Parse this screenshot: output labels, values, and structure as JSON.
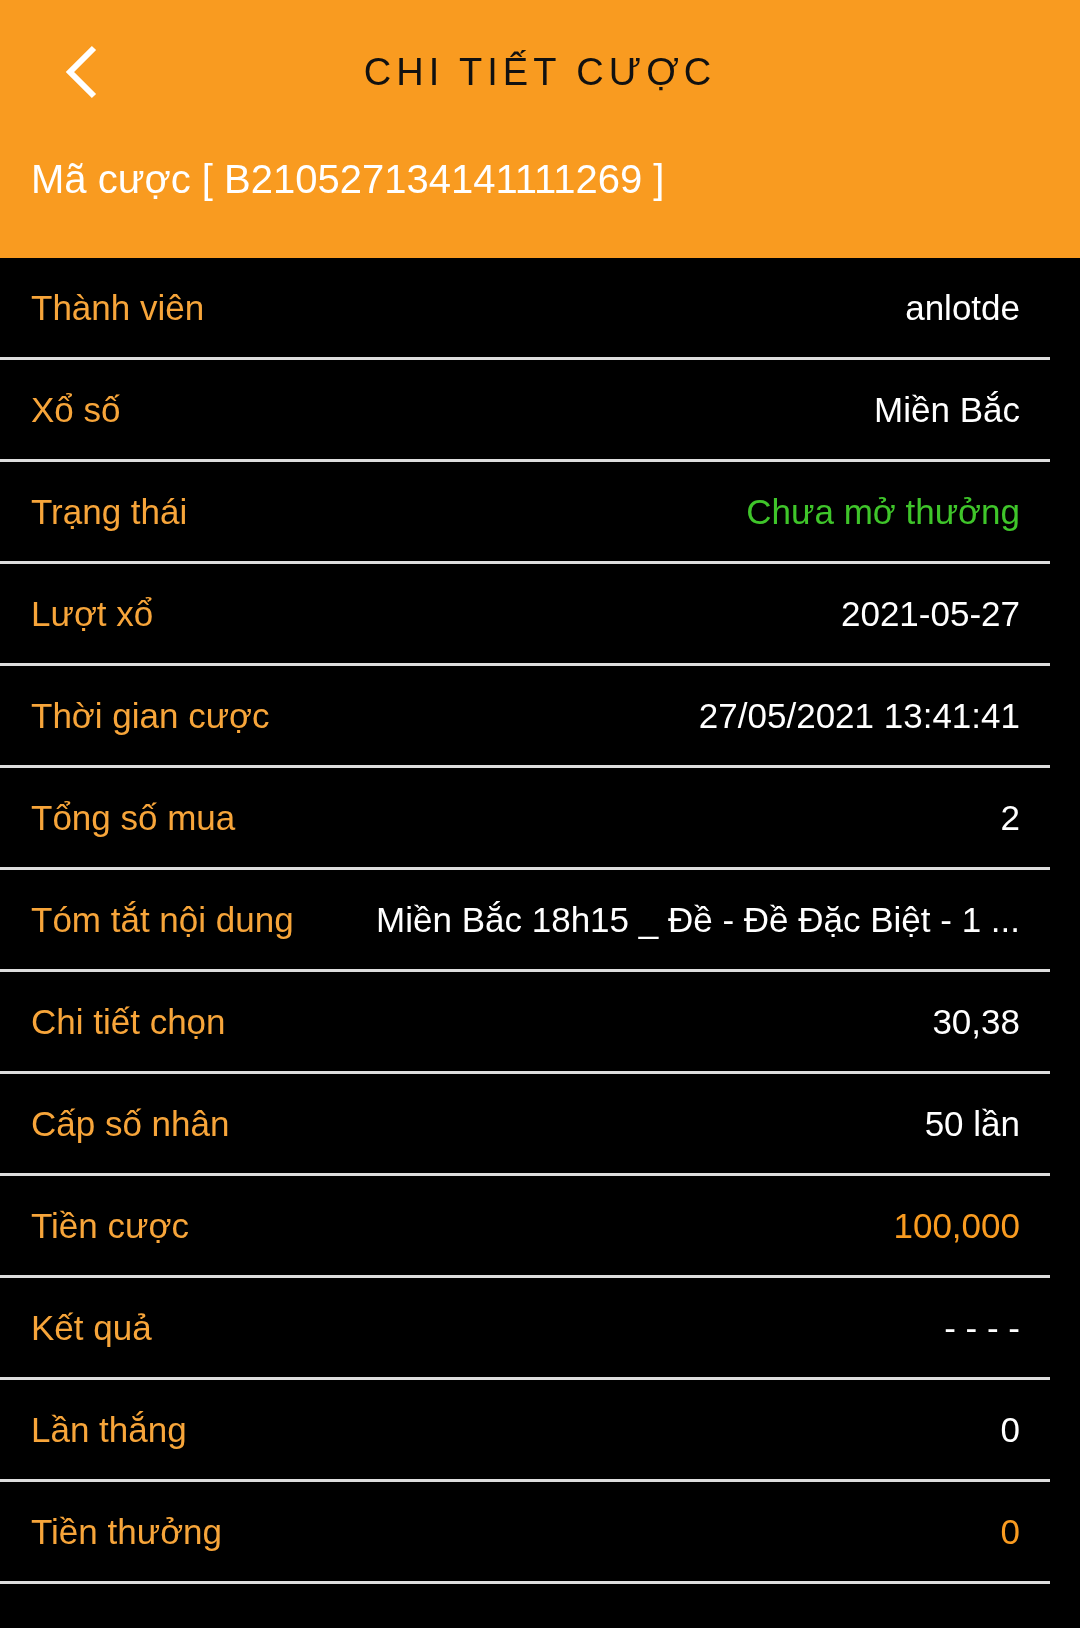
{
  "header": {
    "title": "CHI TIẾT CƯỢC",
    "bet_code": "Mã cược [ B210527134141111269 ]"
  },
  "rows": [
    {
      "label": "Thành viên",
      "value": "anlotde",
      "color": "#ffffff"
    },
    {
      "label": "Xổ số",
      "value": "Miền Bắc",
      "color": "#ffffff"
    },
    {
      "label": "Trạng thái",
      "value": "Chưa mở thưởng",
      "color": "#3fc52a"
    },
    {
      "label": "Lượt xổ",
      "value": "2021-05-27",
      "color": "#ffffff"
    },
    {
      "label": "Thời gian cược",
      "value": "27/05/2021 13:41:41",
      "color": "#ffffff"
    },
    {
      "label": "Tổng số mua",
      "value": "2",
      "color": "#ffffff"
    },
    {
      "label": "Tóm tắt nội dung",
      "value": "Miền Bắc 18h15 _ Đề - Đề Đặc Biệt - 1 ...",
      "color": "#ffffff"
    },
    {
      "label": "Chi tiết chọn",
      "value": "30,38",
      "color": "#ffffff"
    },
    {
      "label": "Cấp số nhân",
      "value": "50 lần",
      "color": "#ffffff"
    },
    {
      "label": "Tiền cược",
      "value": "100,000",
      "color": "#f99b20"
    },
    {
      "label": "Kết quả",
      "value": "- - - -",
      "color": "#ffffff"
    },
    {
      "label": "Lần thắng",
      "value": "0",
      "color": "#ffffff"
    },
    {
      "label": "Tiền thưởng",
      "value": "0",
      "color": "#f99b20"
    }
  ]
}
